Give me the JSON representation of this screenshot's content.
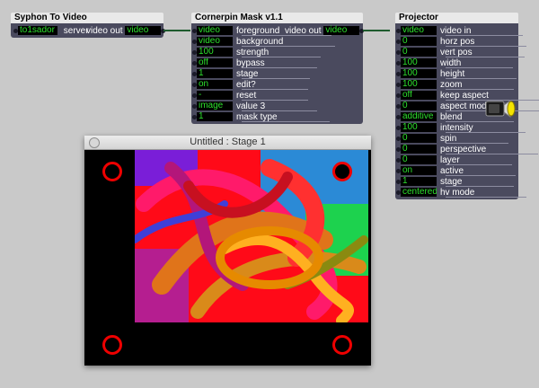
{
  "syphon": {
    "title": "Syphon To Video",
    "server_value": "to1sador",
    "server_label": "server",
    "output_label": "video out",
    "output_value": "video"
  },
  "cornerpin": {
    "title": "Cornerpin Mask v1.1",
    "output_label": "video out",
    "output_value": "video",
    "ports": [
      {
        "value": "video",
        "label": "foreground"
      },
      {
        "value": "video",
        "label": "background"
      },
      {
        "value": "100",
        "label": "strength"
      },
      {
        "value": "off",
        "label": "bypass"
      },
      {
        "value": "1",
        "label": "stage"
      },
      {
        "value": "on",
        "label": "edit?"
      },
      {
        "value": "-",
        "label": "reset"
      },
      {
        "value": "image",
        "label": "value 3"
      },
      {
        "value": "1",
        "label": "mask type"
      }
    ]
  },
  "projector": {
    "title": "Projector",
    "ports": [
      {
        "value": "video",
        "label": "video in"
      },
      {
        "value": "0",
        "label": "horz pos"
      },
      {
        "value": "0",
        "label": "vert pos"
      },
      {
        "value": "100",
        "label": "width"
      },
      {
        "value": "100",
        "label": "height"
      },
      {
        "value": "100",
        "label": "zoom"
      },
      {
        "value": "off",
        "label": "keep aspect"
      },
      {
        "value": "0",
        "label": "aspect mod"
      },
      {
        "value": "additive",
        "label": "blend"
      },
      {
        "value": "100",
        "label": "intensity"
      },
      {
        "value": "0",
        "label": "spin"
      },
      {
        "value": "0",
        "label": "perspective"
      },
      {
        "value": "0",
        "label": "layer"
      },
      {
        "value": "on",
        "label": "active"
      },
      {
        "value": "1",
        "label": "stage"
      },
      {
        "value": "centered",
        "label": "hv mode"
      }
    ]
  },
  "stage_window": {
    "title": "Untitled : Stage 1"
  },
  "colors": {
    "canvas": "#c9c9c9",
    "node_body": "#4a4a5e",
    "value_text": "#2de02d",
    "corner_handle": "#e00000"
  }
}
